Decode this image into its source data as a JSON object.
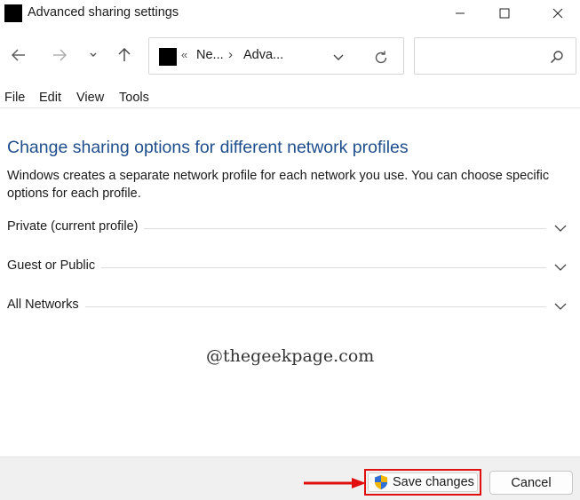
{
  "window": {
    "title": "Advanced sharing settings"
  },
  "address": {
    "chevrons": "«",
    "crumbs": [
      "Ne...",
      "Adva..."
    ],
    "separator": "›"
  },
  "search": {
    "placeholder": ""
  },
  "menu": {
    "items": [
      "File",
      "Edit",
      "View",
      "Tools"
    ]
  },
  "main": {
    "heading": "Change sharing options for different network profiles",
    "description": "Windows creates a separate network profile for each network you use. You can choose specific options for each profile.",
    "profiles": [
      {
        "label": "Private (current profile)"
      },
      {
        "label": "Guest or Public"
      },
      {
        "label": "All Networks"
      }
    ]
  },
  "watermark": "@thegeekpage.com",
  "footer": {
    "save_label": "Save changes",
    "cancel_label": "Cancel"
  },
  "icons": {
    "app": "network-app-icon",
    "back": "arrow-left-icon",
    "forward": "arrow-right-icon",
    "recent": "chevron-down-icon",
    "up": "arrow-up-icon",
    "refresh": "refresh-icon",
    "search": "search-icon",
    "shield": "uac-shield-icon",
    "expand": "chevron-down-icon"
  },
  "colors": {
    "heading": "#1f4e8c",
    "highlight": "#e01010",
    "footer_bg": "#f0f0f0"
  }
}
